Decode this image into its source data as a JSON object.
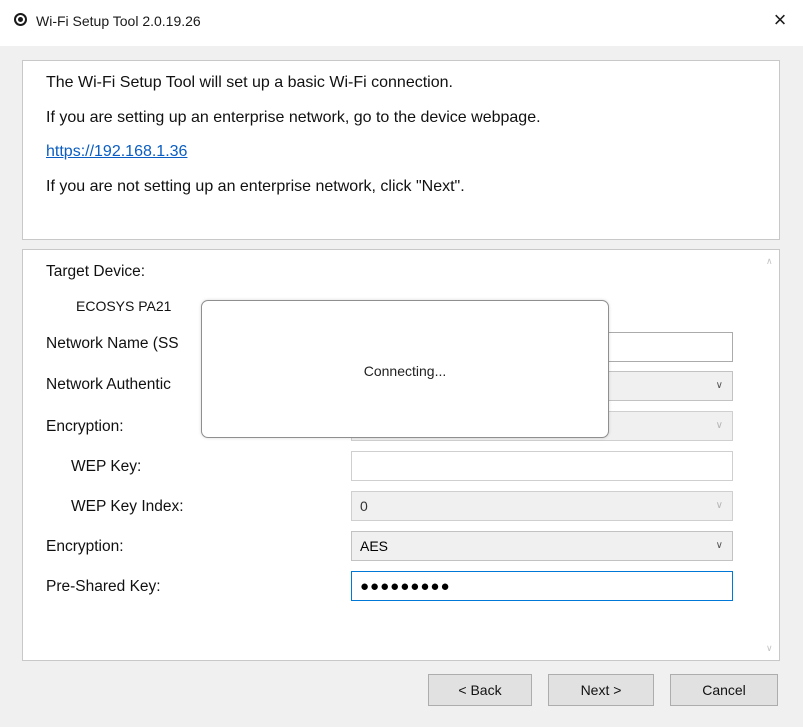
{
  "window": {
    "title": "Wi-Fi Setup Tool 2.0.19.26",
    "close_glyph": "×"
  },
  "info": {
    "line1": "The Wi-Fi Setup Tool will set up a basic Wi-Fi connection.",
    "line2": "If you are setting up an enterprise network, go to the device webpage.",
    "link": "https://192.168.1.36",
    "line3": "If you are not setting up an enterprise network, click \"Next\"."
  },
  "form": {
    "target_device_label": "Target Device:",
    "target_device_value": "ECOSYS PA21",
    "network_name_label": "Network Name (SS",
    "network_name_value": "",
    "network_auth_label": "Network Authentic",
    "network_auth_value": "",
    "encryption1_label": "Encryption:",
    "encryption1_value": "",
    "wep_key_label": "WEP Key:",
    "wep_key_value": "",
    "wep_index_label": "WEP Key Index:",
    "wep_index_value": "0",
    "encryption2_label": "Encryption:",
    "encryption2_value": "AES",
    "psk_label": "Pre-Shared Key:",
    "psk_value": "●●●●●●●●●"
  },
  "modal": {
    "message": "Connecting..."
  },
  "buttons": {
    "back": "< Back",
    "next": "Next >",
    "cancel": "Cancel"
  },
  "icons": {
    "app": "app-icon",
    "close": "close-icon",
    "dropdown": "chevron-down-icon",
    "scroll_up": "scroll-up-icon",
    "scroll_down": "scroll-down-icon"
  },
  "colors": {
    "link": "#0a5dc2",
    "focus_border": "#0078d7",
    "dialog_bg": "#f0f0f0"
  }
}
